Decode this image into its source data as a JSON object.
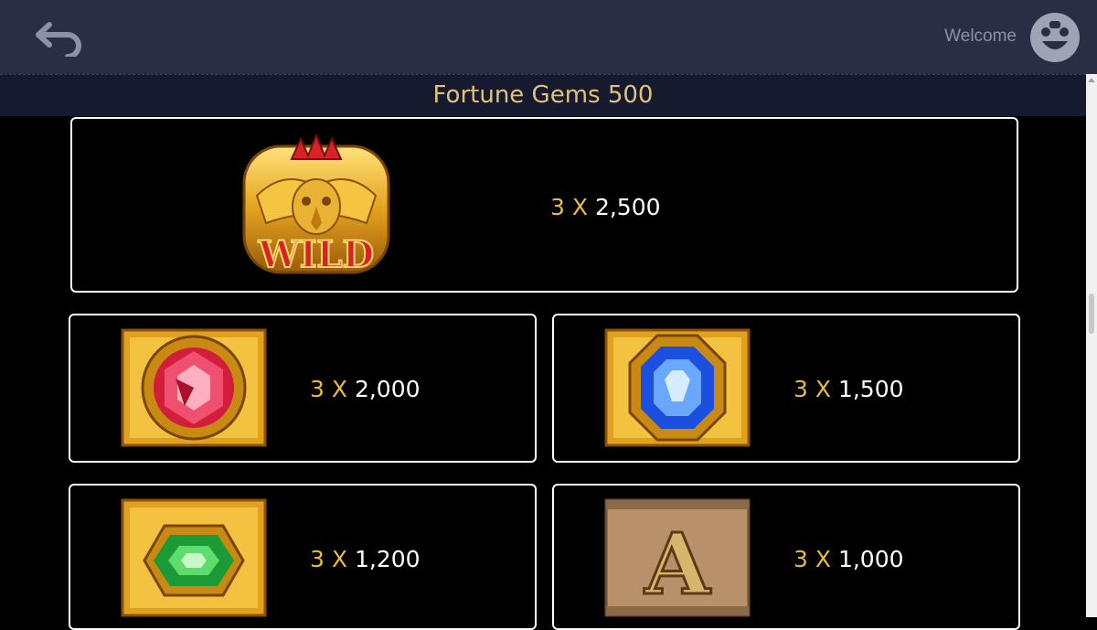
{
  "header": {
    "welcome_text": "Welcome",
    "back_icon": "back-arrow-icon",
    "avatar_icon": "user-avatar-icon"
  },
  "page": {
    "title": "Fortune Gems 500"
  },
  "paytable": [
    {
      "symbol": "wild",
      "symbol_text": "WILD",
      "multiplier": "3 X",
      "payout": "2,500"
    },
    {
      "symbol": "red-gem",
      "multiplier": "3 X",
      "payout": "2,000"
    },
    {
      "symbol": "blue-gem",
      "multiplier": "3 X",
      "payout": "1,500"
    },
    {
      "symbol": "green-gem",
      "multiplier": "3 X",
      "payout": "1,200"
    },
    {
      "symbol": "letter-a",
      "symbol_text": "A",
      "multiplier": "3 X",
      "payout": "1,000"
    }
  ],
  "colors": {
    "header_bg": "#2a2e45",
    "title_bar_bg": "#161a2e",
    "title_text": "#e2c27a",
    "multiplier_text": "#e8bd3a",
    "card_border": "#ffffff"
  }
}
